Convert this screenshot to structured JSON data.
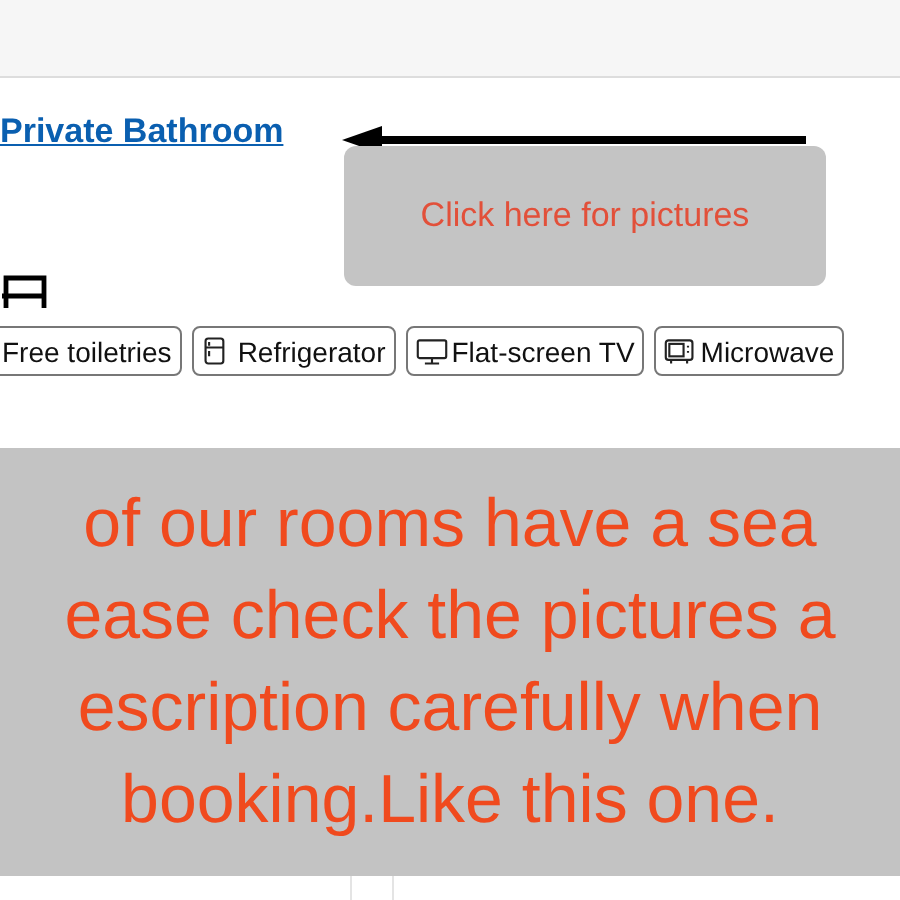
{
  "room_link": "Private Bathroom",
  "callout": {
    "text": "Click here for pictures"
  },
  "facilities": [
    {
      "kind": "none",
      "label": "Free toiletries"
    },
    {
      "kind": "fridge",
      "label": "Refrigerator"
    },
    {
      "kind": "tv",
      "label": "Flat-screen TV"
    },
    {
      "kind": "microwave",
      "label": "Microwave"
    }
  ],
  "notice": {
    "lines": [
      "of our rooms have a sea",
      "ease check the pictures a",
      "escription carefully when",
      "booking.Like this one."
    ]
  }
}
